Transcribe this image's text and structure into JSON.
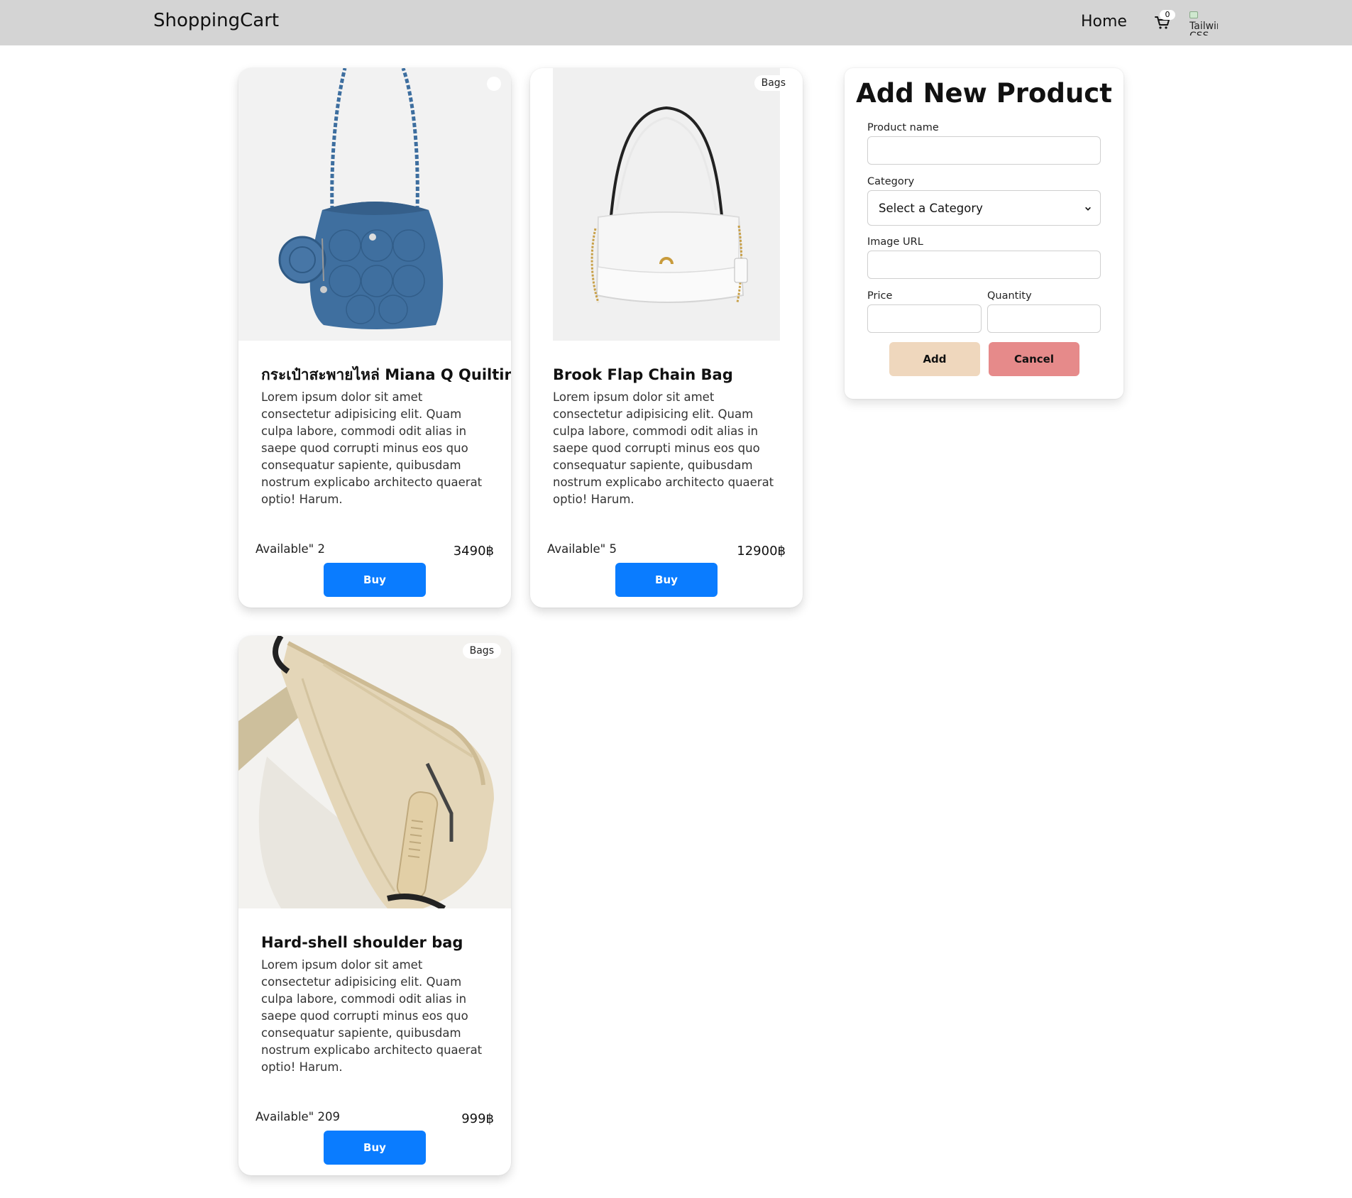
{
  "navbar": {
    "brand": "ShoppingCart",
    "home": "Home",
    "cart_count": "0",
    "avatar_alt": "Tailwind CSS"
  },
  "products": [
    {
      "title": "กระเป๋าสะพายไหล่ Miana Q Quilting",
      "description": "Lorem ipsum dolor sit amet consectetur adipisicing elit. Quam culpa labore, commodi odit alias in saepe quod corrupti minus eos quo consequatur sapiente, quibusdam nostrum explicabo architecto quaerat optio! Harum.",
      "available": "Available\" 2",
      "price": "3490฿",
      "buy": "Buy",
      "tag": ""
    },
    {
      "title": "Brook Flap Chain Bag",
      "description": "Lorem ipsum dolor sit amet consectetur adipisicing elit. Quam culpa labore, commodi odit alias in saepe quod corrupti minus eos quo consequatur sapiente, quibusdam nostrum explicabo architecto quaerat optio! Harum.",
      "available": "Available\" 5",
      "price": "12900฿",
      "buy": "Buy",
      "tag": "Bags"
    },
    {
      "title": "Hard-shell shoulder bag",
      "description": "Lorem ipsum dolor sit amet consectetur adipisicing elit. Quam culpa labore, commodi odit alias in saepe quod corrupti minus eos quo consequatur sapiente, quibusdam nostrum explicabo architecto quaerat optio! Harum.",
      "available": "Available\" 209",
      "price": "999฿",
      "buy": "Buy",
      "tag": "Bags"
    }
  ],
  "form": {
    "title": "Add New Product",
    "product_name_label": "Product name",
    "product_name_value": "",
    "category_label": "Category",
    "category_selected": "Select a Category",
    "image_url_label": "Image URL",
    "image_url_value": "",
    "price_label": "Price",
    "price_value": "",
    "quantity_label": "Quantity",
    "quantity_value": "",
    "add_button": "Add",
    "cancel_button": "Cancel"
  },
  "colors": {
    "navbar_bg": "#d4d4d4",
    "buy_button": "#0a7cff",
    "add_button": "#efd7bd",
    "cancel_button": "#e68a8a"
  }
}
